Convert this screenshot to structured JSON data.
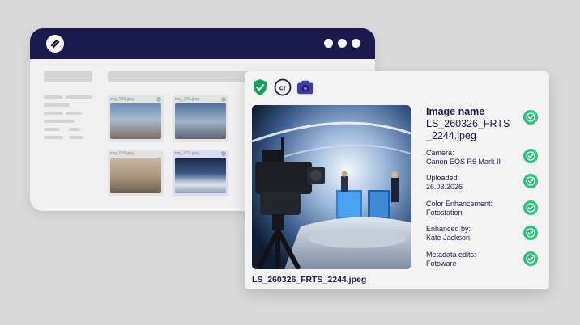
{
  "window": {
    "dots": [
      "",
      "",
      ""
    ]
  },
  "thumbnails": [
    {
      "label": "img_033.jpeg"
    },
    {
      "label": "img_209.jpeg"
    },
    {
      "label": "img_016.jpeg"
    },
    {
      "label": "img_010.jpeg"
    }
  ],
  "card": {
    "icons": [
      "shield-check-icon",
      "cr-content-credentials-icon",
      "camera-icon"
    ],
    "filename": "LS_260326_FRTS_2244.jpeg",
    "fields": [
      {
        "label": "Image name",
        "value": "LS_260326_FRTS _2244.jpeg"
      },
      {
        "label": "Camera:",
        "value": "Canon EOS R6 Mark II"
      },
      {
        "label": "Uploaded:",
        "value": "26.03.2026"
      },
      {
        "label": "Color Enhancement:",
        "value": "Fotostation"
      },
      {
        "label": "Enhanced by:",
        "value": "Kate Jackson"
      },
      {
        "label": "Metadata edits:",
        "value": "Fotoware"
      }
    ]
  },
  "colors": {
    "navy": "#1b1a4e",
    "green": "#2fc27c",
    "shield": "#14a35a",
    "camera": "#3a3aa8"
  }
}
